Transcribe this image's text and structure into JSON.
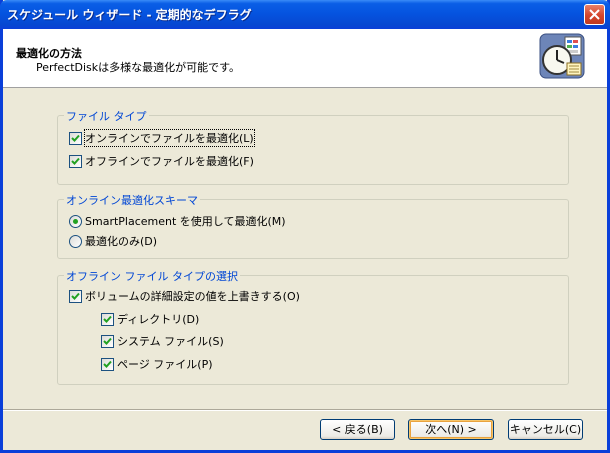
{
  "window": {
    "title": "スケジュール ウィザード - 定期的なデフラグ"
  },
  "header": {
    "title": "最適化の方法",
    "subtitle": "PerfectDiskは多様な最適化が可能です。"
  },
  "file_type_group": {
    "title": "ファイル タイプ",
    "online_label": "オンラインでファイルを最適化(L)",
    "online_checked": true,
    "offline_label": "オフラインでファイルを最適化(F)",
    "offline_checked": true
  },
  "online_schema_group": {
    "title": "オンライン最適化スキーマ",
    "options": [
      {
        "label": "SmartPlacement を使用して最適化(M)",
        "selected": true
      },
      {
        "label": "最適化のみ(D)",
        "selected": false
      }
    ]
  },
  "offline_group": {
    "title": "オフライン ファイル タイプの選択",
    "override_label": "ボリュームの詳細設定の値を上書きする(O)",
    "items": [
      {
        "label": "ディレクトリ(D)",
        "checked": true
      },
      {
        "label": "システム ファイル(S)",
        "checked": true
      },
      {
        "label": "ページ ファイル(P)",
        "checked": true
      }
    ]
  },
  "buttons": {
    "back": "< 戻る(B)",
    "next": "次へ(N) >",
    "cancel": "キャンセル(C)"
  }
}
